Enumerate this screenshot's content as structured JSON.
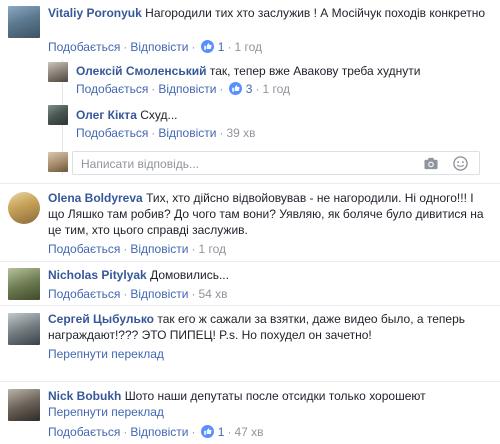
{
  "actions": {
    "like": "Подобається",
    "reply": "Відповісти",
    "translate": "Перепнути переклад"
  },
  "comments": [
    {
      "author": "Vitaliy Poronyuk",
      "text": "Нагородили тих хто заслужив ! А Мосійчук походів конкретно",
      "likes": "1",
      "time": "1 год"
    },
    {
      "author": "Олексій Смоленський",
      "text": "так, тепер вже Авакову треба худнути",
      "likes": "3",
      "time": "1 год"
    },
    {
      "author": "Олег Кікта",
      "text": "Схуд...",
      "time": "39 хв"
    },
    {
      "author": "Olena Boldyreva",
      "text": "Тих, хто дійсно відвойовував - не нагородили. Ні одного!!! І що Ляшко там робив? До чого там вони? Уявляю, як боляче було дивитися на це тим, хто цього справді заслужив.",
      "time": "1 год"
    },
    {
      "author": "Nicholas Pitylyak",
      "text": "Домовились...",
      "time": "54 хв"
    },
    {
      "author": "Сергей Цыбулько",
      "text": "так его ж сажали за взятки, даже видео было, а теперь награждают!??? ЭТО ПИПЕЦ! P.s. Но похудел он зачетно!",
      "time": ""
    },
    {
      "author": "Nick Bobukh",
      "text": "Шото наши депутаты после отсидки только хорошеют",
      "likes": "1",
      "time": "47 хв"
    }
  ],
  "reply_input": {
    "placeholder": "Написати відповідь..."
  },
  "icons": {
    "like": "thumbs-up-icon",
    "camera": "camera-icon",
    "emoji": "emoji-icon"
  },
  "colors": {
    "link": "#365899",
    "action": "#4267b2",
    "meta": "#90949c"
  }
}
